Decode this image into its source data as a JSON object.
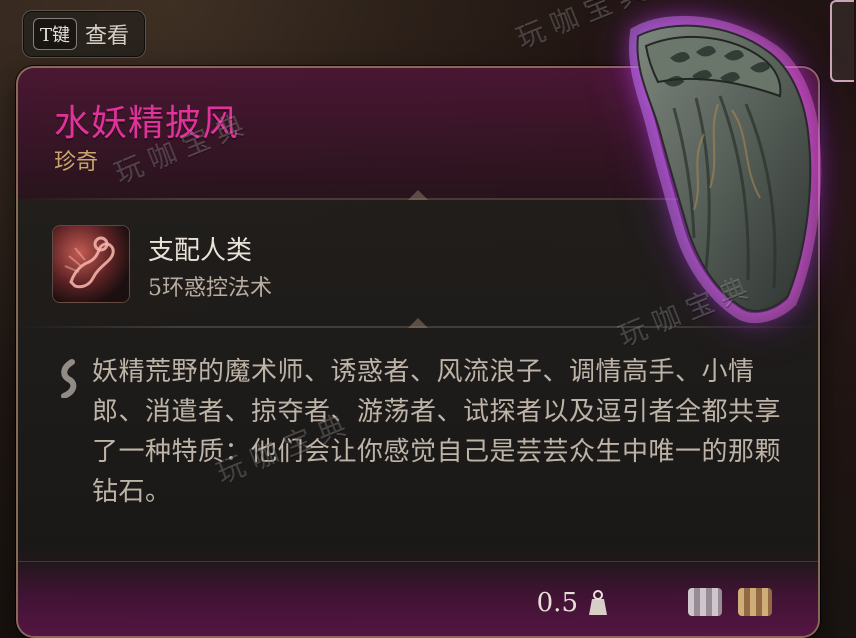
{
  "hint": {
    "key": "T键",
    "label": "查看"
  },
  "item": {
    "name": "水妖精披风",
    "rarity": "珍奇",
    "name_color": "#e1329b",
    "rarity_color": "#c9a76b"
  },
  "spell": {
    "name": "支配人类",
    "subtitle": "5环惑控法术"
  },
  "description": "妖精荒野的魔术师、诱惑者、风流浪子、调情高手、小情郎、消遣者、掠夺者、游荡者、试探者以及逗引者全都共享了一种特质：他们会让你感觉自己是芸芸众生中唯一的那颗钻石。",
  "footer": {
    "weight": "0.5"
  },
  "watermark": {
    "text": "玩咖宝典"
  },
  "icons": {
    "key_hint": "keycap",
    "spell": "dominate-person-icon",
    "description_quote": "quote-mark-icon",
    "weight": "weight-icon"
  }
}
